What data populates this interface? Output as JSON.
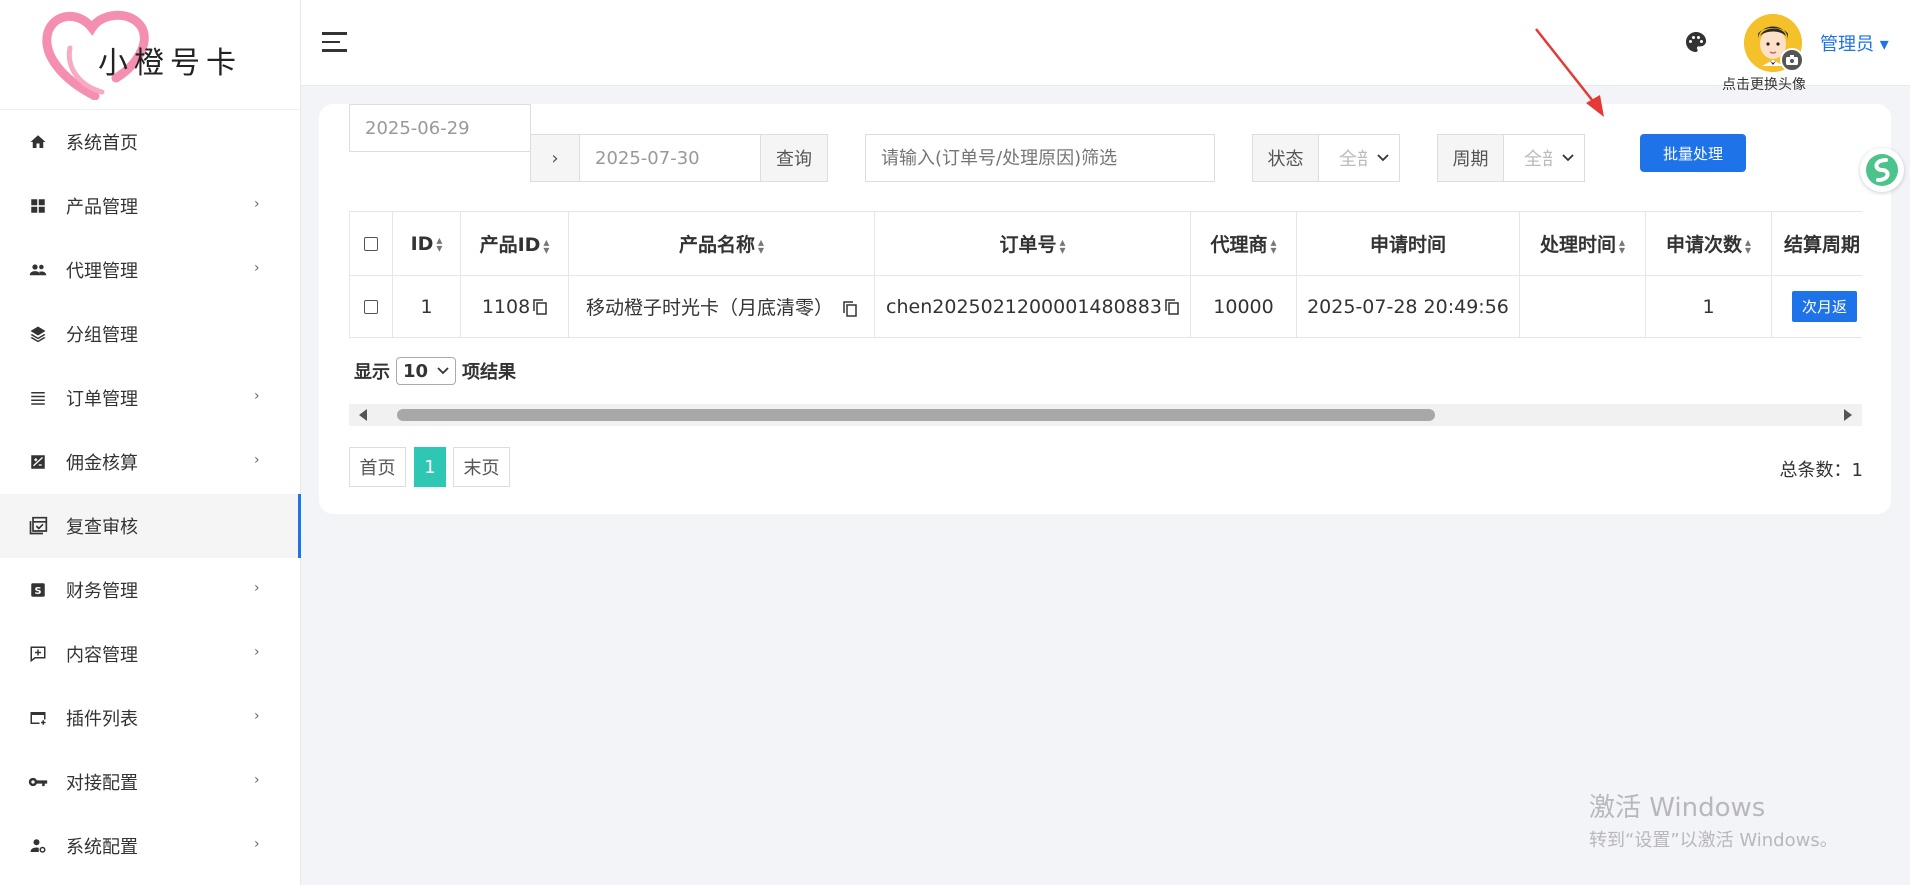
{
  "logo": {
    "text": "小橙号卡"
  },
  "sidebar": {
    "items": [
      {
        "label": "系统首页",
        "icon": "home-icon",
        "has_children": false
      },
      {
        "label": "产品管理",
        "icon": "grid-icon",
        "has_children": true
      },
      {
        "label": "代理管理",
        "icon": "people-icon",
        "has_children": true
      },
      {
        "label": "分组管理",
        "icon": "layers-icon",
        "has_children": false
      },
      {
        "label": "订单管理",
        "icon": "list-icon",
        "has_children": true
      },
      {
        "label": "佣金核算",
        "icon": "chart-box-icon",
        "has_children": true
      },
      {
        "label": "复查审核",
        "icon": "calendar-check-icon",
        "has_children": false,
        "active": true
      },
      {
        "label": "财务管理",
        "icon": "dollar-box-icon",
        "has_children": true
      },
      {
        "label": "内容管理",
        "icon": "comment-plus-icon",
        "has_children": true
      },
      {
        "label": "插件列表",
        "icon": "card-plus-icon",
        "has_children": true
      },
      {
        "label": "对接配置",
        "icon": "key-icon",
        "has_children": true
      },
      {
        "label": "系统配置",
        "icon": "user-cog-icon",
        "has_children": true
      }
    ]
  },
  "header": {
    "avatar_hint": "点击更换头像",
    "admin_name": "管理员 ▾"
  },
  "toolbar": {
    "date_start": "2025-06-29",
    "date_sep": "›",
    "date_end": "2025-07-30",
    "query_label": "查询",
    "search_placeholder": "请输入(订单号/处理原因)筛选",
    "status_label": "状态",
    "status_value": "全部",
    "period_label": "周期",
    "period_value": "全部",
    "batch_label": "批量处理"
  },
  "table": {
    "headers": [
      "ID",
      "产品ID",
      "产品名称",
      "订单号",
      "代理商",
      "申请时间",
      "处理时间",
      "申请次数",
      "结算周期"
    ],
    "rows": [
      {
        "id": "1",
        "product_id": "1108",
        "product_name": "移动橙子时光卡（月底清零）",
        "order_no": "chen2025021200001480883",
        "agent": "10000",
        "apply_time": "2025-07-28 20:49:56",
        "process_time": "",
        "apply_count": "1",
        "period": "次月返"
      }
    ]
  },
  "pagination": {
    "show_label": "显示",
    "page_size": "10",
    "result_label": "项结果",
    "first": "首页",
    "current": "1",
    "last": "末页",
    "total": "总条数：1"
  },
  "watermark": {
    "line1": "激活 Windows",
    "line2": "转到“设置”以激活 Windows。"
  },
  "colors": {
    "primary": "#1e73e8",
    "pager_active": "#2ec7b3",
    "logo_heart": "#f48fb1"
  }
}
